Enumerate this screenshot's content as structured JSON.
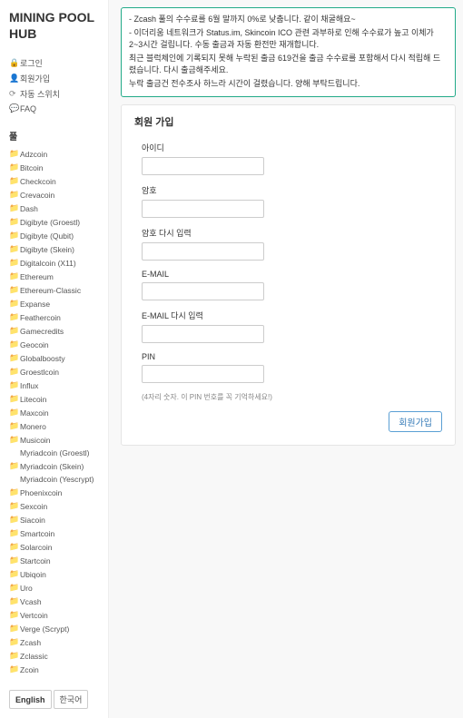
{
  "logo": "MINING POOL HUB",
  "topnav": [
    {
      "icon": "lock",
      "label": "로그인"
    },
    {
      "icon": "user",
      "label": "회원가입"
    },
    {
      "icon": "refresh",
      "label": "자동 스위치"
    },
    {
      "icon": "chat",
      "label": "FAQ"
    }
  ],
  "pool_header": "풀",
  "pools": [
    "Adzcoin",
    "Bitcoin",
    "Checkcoin",
    "Crevacoin",
    "Dash",
    "Digibyte (Groestl)",
    "Digibyte (Qubit)",
    "Digibyte (Skein)",
    "Digitalcoin (X11)",
    "Ethereum",
    "Ethereum-Classic",
    "Expanse",
    "Feathercoin",
    "Gamecredits",
    "Geocoin",
    "Globalboosty",
    "Groestlcoin",
    "Influx",
    "Litecoin",
    "Maxcoin",
    "Monero",
    "Musicoin",
    "Myriadcoin (Groestl)",
    "Myriadcoin (Skein)",
    "Myriadcoin (Yescrypt)",
    "Phoenixcoin",
    "Sexcoin",
    "Siacoin",
    "Smartcoin",
    "Solarcoin",
    "Startcoin",
    "Ubiqoin",
    "Uro",
    "Vcash",
    "Vertcoin",
    "Verge (Scrypt)",
    "Zcash",
    "Zclassic",
    "Zcoin"
  ],
  "pools_no_icon_idx": [
    22,
    24
  ],
  "lang": {
    "en": "English",
    "ko": "한국어"
  },
  "notice": [
    "- Zcash 풀의 수수료를 6월 말까지 0%로 낮춥니다. 같이 채굴해요~",
    "- 이더리움 네트워크가 Status.im, Skincoin ICO 관련 과부하로 인해 수수료가 높고 이체가 2~3시간 걸립니다. 수동 출금과 자동 환전만 재개합니다.",
    "  최근 블럭체인에 기록되지 못해 누락된 출금 619건을 출금 수수료를 포함해서 다시 적립해 드렸습니다. 다시 출금해주세요.",
    "  누락 출금건 전수조사 하느라 시간이 걸렸습니다. 양해 부탁드립니다."
  ],
  "form": {
    "title": "회원 가입",
    "fields": {
      "username": "아이디",
      "password": "암호",
      "password2": "암호 다시 입력",
      "email": "E-MAIL",
      "email2": "E-MAIL 다시 입력",
      "pin": "PIN"
    },
    "pin_note": "(4자리 숫자. 이 PIN 번호를 꼭 기억하세요!)",
    "submit": "회원가입"
  }
}
